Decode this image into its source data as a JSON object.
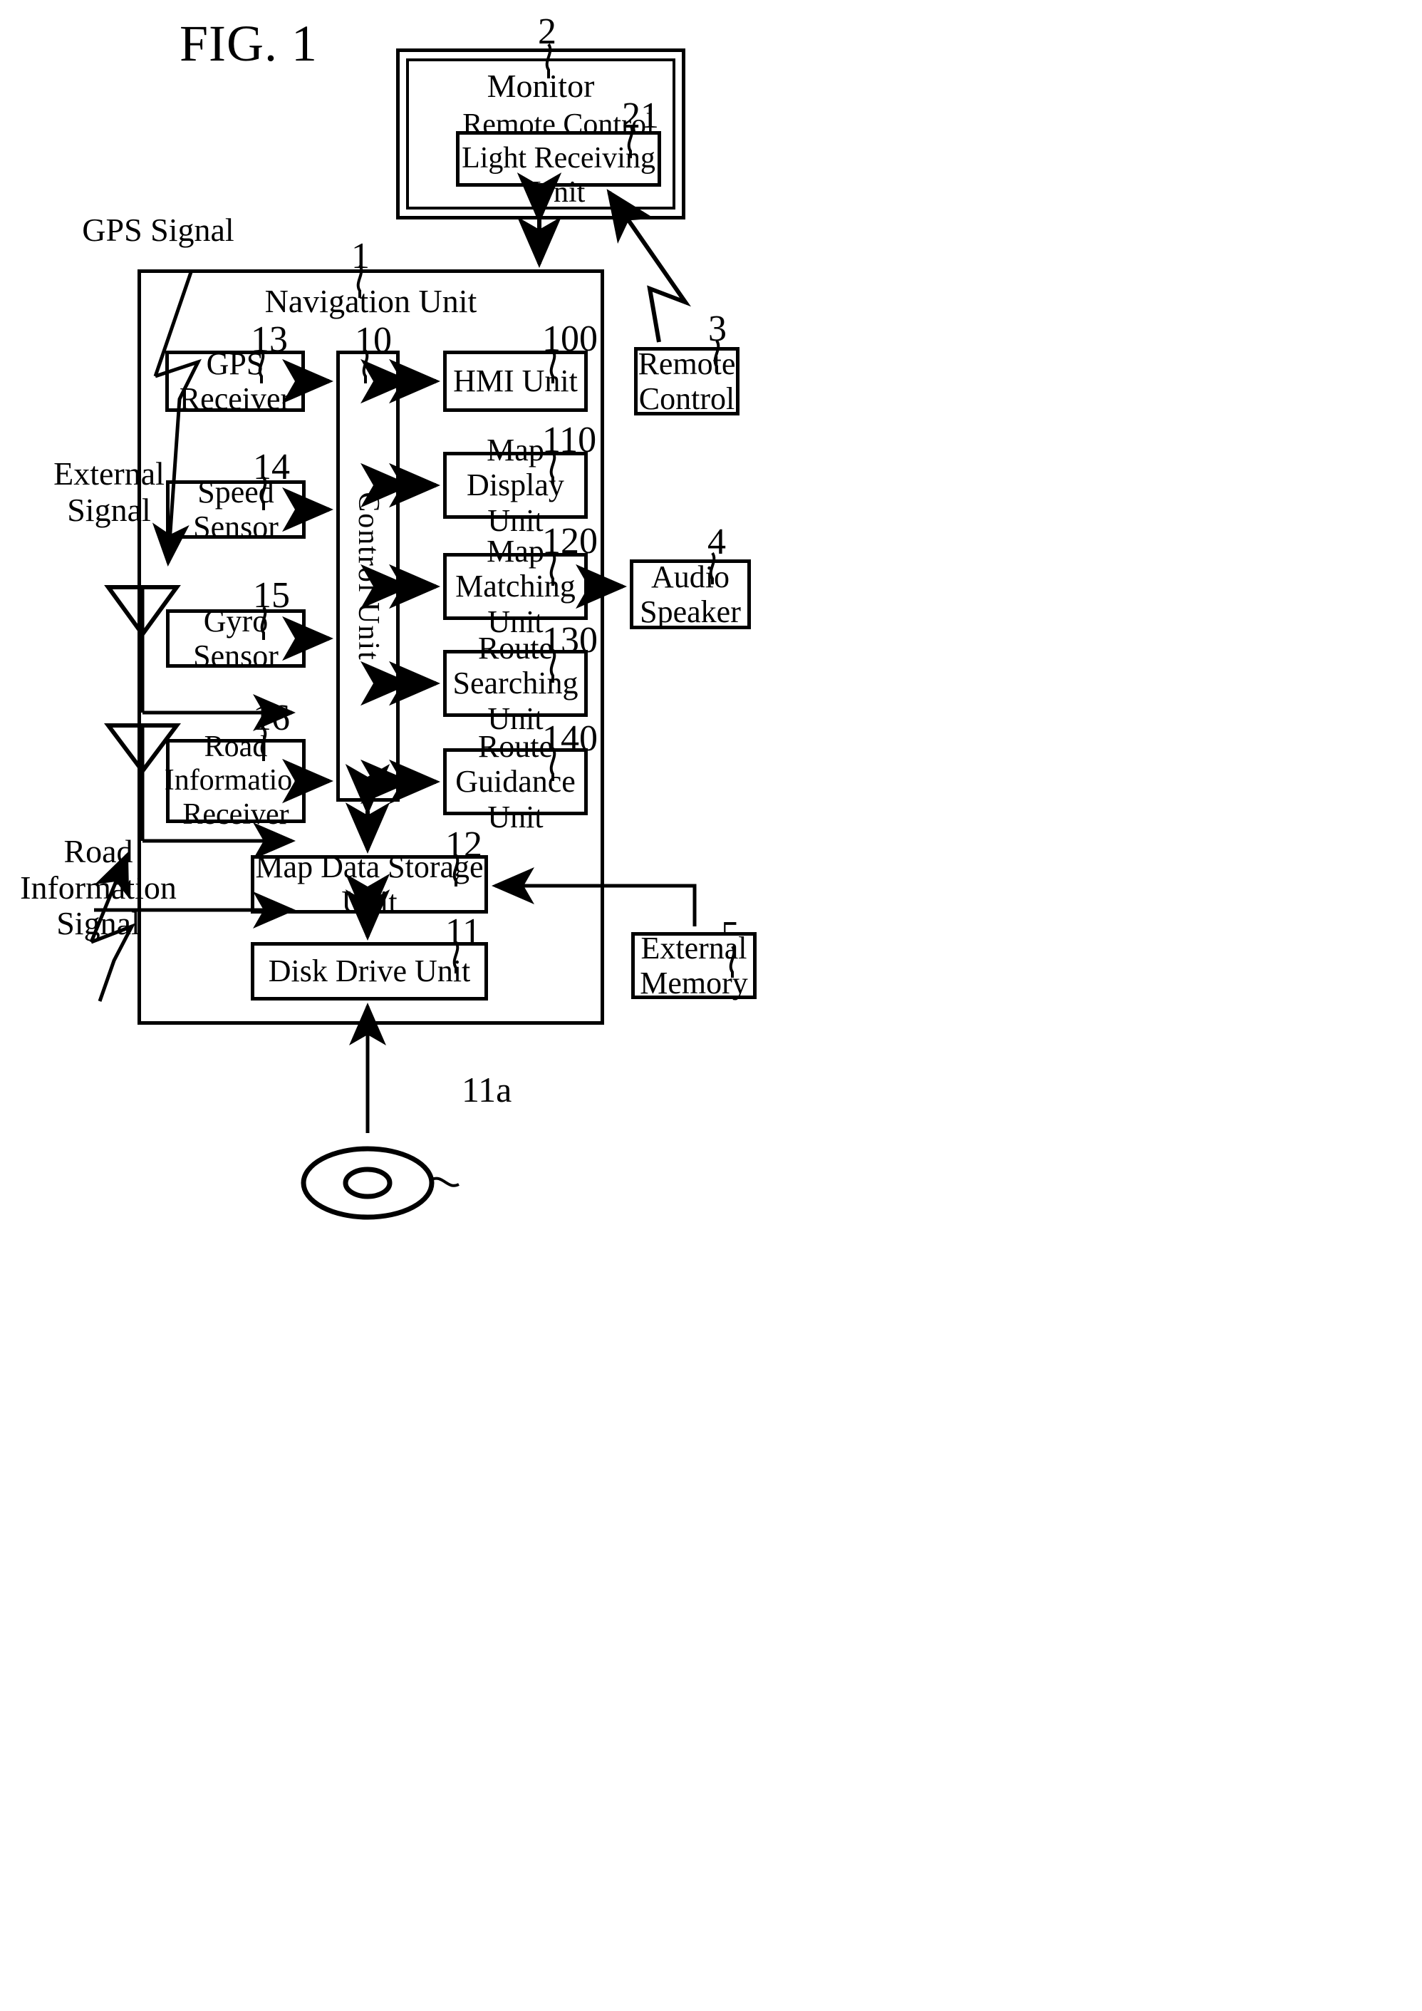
{
  "figure": {
    "title": "FIG. 1"
  },
  "monitor": {
    "ref": "2",
    "title": "Monitor",
    "receiver": {
      "ref": "21",
      "label": "Remote Control\nLight Receiving Unit",
      "line1": "Remote Control",
      "line2": "Light Receiving Unit"
    }
  },
  "remote_control": {
    "ref": "3",
    "line1": "Remote",
    "line2": "Control"
  },
  "audio_speaker": {
    "ref": "4",
    "line1": "Audio",
    "line2": "Speaker"
  },
  "external_memory": {
    "ref": "5",
    "line1": "External",
    "line2": "Memory"
  },
  "navigation_unit": {
    "ref": "1",
    "title": "Navigation Unit",
    "control_unit": {
      "ref": "10",
      "label": "Control Unit"
    },
    "inputs": [
      {
        "ref": "13",
        "label": "GPS Receiver",
        "lines": [
          "GPS Receiver"
        ]
      },
      {
        "ref": "14",
        "label": "Speed Sensor",
        "lines": [
          "Speed Sensor"
        ]
      },
      {
        "ref": "15",
        "label": "Gyro Sensor",
        "lines": [
          "Gyro Sensor"
        ]
      },
      {
        "ref": "16",
        "label": "Road Information Receiver",
        "lines": [
          "Road",
          "Information",
          "Receiver"
        ]
      }
    ],
    "modules": [
      {
        "ref": "100",
        "label": "HMI Unit",
        "lines": [
          "HMI Unit"
        ]
      },
      {
        "ref": "110",
        "label": "Map Display Unit",
        "lines": [
          "Map Display",
          "Unit"
        ]
      },
      {
        "ref": "120",
        "label": "Map Matching Unit",
        "lines": [
          "Map",
          "Matching Unit"
        ]
      },
      {
        "ref": "130",
        "label": "Route Searching Unit",
        "lines": [
          "Route",
          "Searching Unit"
        ]
      },
      {
        "ref": "140",
        "label": "Route Guidance Unit",
        "lines": [
          "Route",
          "Guidance Unit"
        ]
      }
    ],
    "storage": [
      {
        "ref": "12",
        "label": "Map Data Storage Unit"
      },
      {
        "ref": "11",
        "label": "Disk Drive Unit"
      }
    ]
  },
  "disk": {
    "ref": "11a"
  },
  "signals": {
    "gps": {
      "label": "GPS Signal",
      "lines": [
        "GPS Signal"
      ]
    },
    "external": {
      "label": "External Signal",
      "lines": [
        "External",
        "Signal"
      ]
    },
    "road": {
      "label": "Road Information Signal",
      "lines": [
        "Road",
        "Information",
        "Signal"
      ]
    }
  }
}
